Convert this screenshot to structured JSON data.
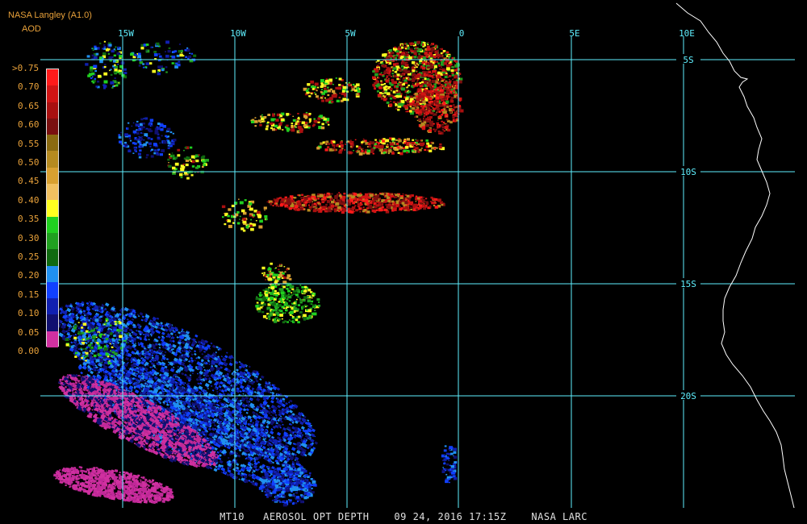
{
  "header": {
    "source": "NASA Langley (A1.0)",
    "product": "AOD"
  },
  "footer": {
    "sensor": "MT10",
    "product": "AEROSOL OPT DEPTH",
    "date": "09 24, 2016",
    "time": "17:15Z",
    "agency": "NASA LARC"
  },
  "legend": {
    "labels": [
      ">0.75",
      "0.70",
      "0.65",
      "0.60",
      "0.55",
      "0.50",
      "0.45",
      "0.40",
      "0.35",
      "0.30",
      "0.25",
      "0.20",
      "0.15",
      "0.10",
      "0.05",
      "0.00"
    ],
    "colors": [
      "#ff1a1a",
      "#d01414",
      "#a81010",
      "#7a1010",
      "#8a6a10",
      "#b58a20",
      "#d8a030",
      "#f0c060",
      "#ffff20",
      "#20d020",
      "#20a020",
      "#106a10",
      "#2090f0",
      "#1040ff",
      "#1020b0",
      "#101070",
      "#d030a0"
    ]
  },
  "grid": {
    "lon_labels": [
      "15W",
      "10W",
      "5W",
      "0",
      "5E",
      "10E"
    ],
    "lat_labels": [
      "5S",
      "10S",
      "15S",
      "20S"
    ],
    "line_color": "#5ff0ff"
  },
  "colors": {
    "background": "#000000",
    "header_text": "#e8a13a",
    "footer_text": "#e0e0e0",
    "coastline": "#ffffff"
  }
}
